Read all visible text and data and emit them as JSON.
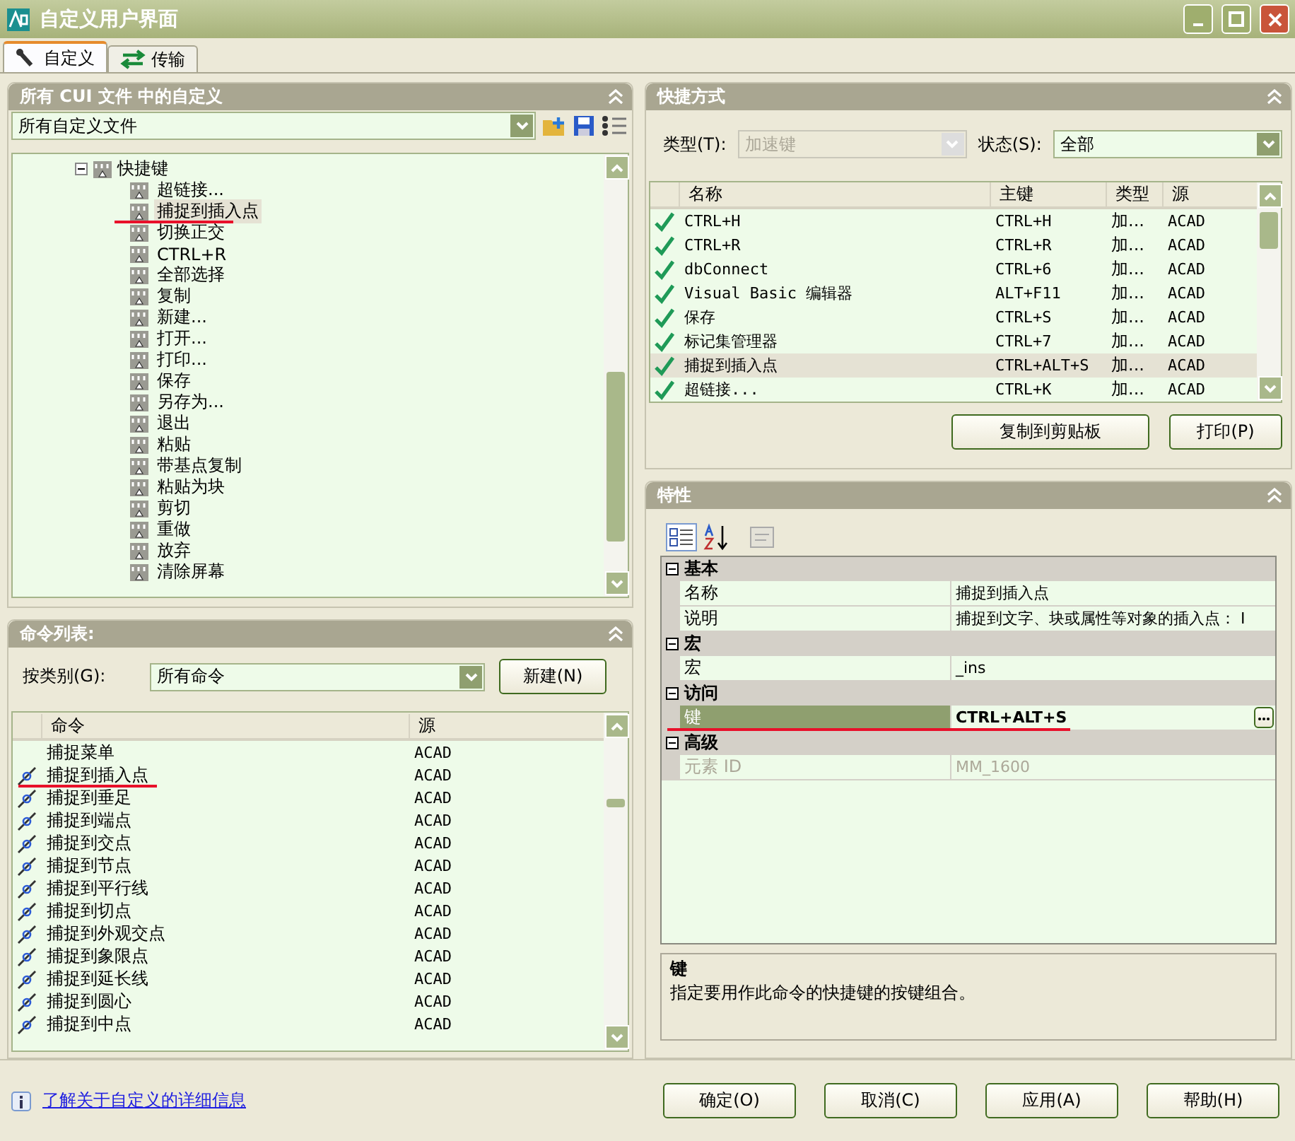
{
  "window": {
    "title": "自定义用户界面"
  },
  "tabs": [
    {
      "label": "自定义",
      "selected": true
    },
    {
      "label": "传输",
      "selected": false
    }
  ],
  "cui_panel": {
    "title": "所有 CUI 文件 中的自定义",
    "file_select": "所有自定义文件",
    "tree": {
      "label": "快捷键",
      "expanded": true,
      "children": [
        {
          "label": "超链接...",
          "selected": false,
          "marked": false
        },
        {
          "label": "捕捉到插入点",
          "selected": true,
          "marked": true
        },
        {
          "label": "切换正交",
          "selected": false,
          "marked": false
        },
        {
          "label": "CTRL+R",
          "selected": false,
          "marked": false
        },
        {
          "label": "全部选择",
          "selected": false,
          "marked": false
        },
        {
          "label": "复制",
          "selected": false,
          "marked": false
        },
        {
          "label": "新建...",
          "selected": false,
          "marked": false
        },
        {
          "label": "打开...",
          "selected": false,
          "marked": false
        },
        {
          "label": "打印...",
          "selected": false,
          "marked": false
        },
        {
          "label": "保存",
          "selected": false,
          "marked": false
        },
        {
          "label": "另存为...",
          "selected": false,
          "marked": false
        },
        {
          "label": "退出",
          "selected": false,
          "marked": false
        },
        {
          "label": "粘贴",
          "selected": false,
          "marked": false
        },
        {
          "label": "带基点复制",
          "selected": false,
          "marked": false
        },
        {
          "label": "粘贴为块",
          "selected": false,
          "marked": false
        },
        {
          "label": "剪切",
          "selected": false,
          "marked": false
        },
        {
          "label": "重做",
          "selected": false,
          "marked": false
        },
        {
          "label": "放弃",
          "selected": false,
          "marked": false
        },
        {
          "label": "清除屏幕",
          "selected": false,
          "marked": false
        }
      ]
    }
  },
  "command_panel": {
    "title": "命令列表:",
    "category_label": "按类别(G):",
    "category": "所有命令",
    "new_button": "新建(N)",
    "columns": [
      "命令",
      "源"
    ],
    "rows": [
      {
        "kind": "menu",
        "command": "捕捉菜单",
        "source": "ACAD",
        "selected": false,
        "marked": false
      },
      {
        "kind": "snap",
        "command": "捕捉到插入点",
        "source": "ACAD",
        "selected": false,
        "marked": true
      },
      {
        "kind": "snap",
        "command": "捕捉到垂足",
        "source": "ACAD",
        "selected": false,
        "marked": false
      },
      {
        "kind": "snap",
        "command": "捕捉到端点",
        "source": "ACAD",
        "selected": false,
        "marked": false
      },
      {
        "kind": "snap",
        "command": "捕捉到交点",
        "source": "ACAD",
        "selected": false,
        "marked": false
      },
      {
        "kind": "snap",
        "command": "捕捉到节点",
        "source": "ACAD",
        "selected": false,
        "marked": false
      },
      {
        "kind": "snap",
        "command": "捕捉到平行线",
        "source": "ACAD",
        "selected": false,
        "marked": false
      },
      {
        "kind": "snap",
        "command": "捕捉到切点",
        "source": "ACAD",
        "selected": false,
        "marked": false
      },
      {
        "kind": "snap",
        "command": "捕捉到外观交点",
        "source": "ACAD",
        "selected": false,
        "marked": false
      },
      {
        "kind": "snap",
        "command": "捕捉到象限点",
        "source": "ACAD",
        "selected": false,
        "marked": false
      },
      {
        "kind": "snap",
        "command": "捕捉到延长线",
        "source": "ACAD",
        "selected": false,
        "marked": false
      },
      {
        "kind": "snap",
        "command": "捕捉到圆心",
        "source": "ACAD",
        "selected": false,
        "marked": false
      },
      {
        "kind": "snap",
        "command": "捕捉到中点",
        "source": "ACAD",
        "selected": false,
        "marked": false
      }
    ]
  },
  "info_link": "了解关于自定义的详细信息",
  "shortcut_panel": {
    "title": "快捷方式",
    "type_label": "类型(T):",
    "type_value": "加速键",
    "type_disabled": true,
    "status_label": "状态(S):",
    "status_value": "全部",
    "columns": [
      "名称",
      "主键",
      "类型",
      "源"
    ],
    "rows": [
      {
        "name": "CTRL+H",
        "key": "CTRL+H",
        "type": "加...",
        "source": "ACAD",
        "selected": false
      },
      {
        "name": "CTRL+R",
        "key": "CTRL+R",
        "type": "加...",
        "source": "ACAD",
        "selected": false
      },
      {
        "name": "dbConnect",
        "key": "CTRL+6",
        "type": "加...",
        "source": "ACAD",
        "selected": false
      },
      {
        "name": "Visual Basic 编辑器",
        "key": "ALT+F11",
        "type": "加...",
        "source": "ACAD",
        "selected": false
      },
      {
        "name": "保存",
        "key": "CTRL+S",
        "type": "加...",
        "source": "ACAD",
        "selected": false
      },
      {
        "name": "标记集管理器",
        "key": "CTRL+7",
        "type": "加...",
        "source": "ACAD",
        "selected": false
      },
      {
        "name": "捕捉到插入点",
        "key": "CTRL+ALT+S",
        "type": "加...",
        "source": "ACAD",
        "selected": true
      },
      {
        "name": "超链接...",
        "key": "CTRL+K",
        "type": "加...",
        "source": "ACAD",
        "selected": false
      }
    ],
    "buttons": [
      "复制到剪贴板",
      "打印(P)"
    ]
  },
  "properties_panel": {
    "title": "特性",
    "groups": [
      {
        "name": "基本",
        "expanded": true,
        "rows": [
          {
            "label": "名称",
            "value": "捕捉到插入点",
            "selected": false
          },
          {
            "label": "说明",
            "value": "捕捉到文字、块或属性等对象的插入点： I",
            "selected": false
          }
        ]
      },
      {
        "name": "宏",
        "expanded": true,
        "rows": [
          {
            "label": "宏",
            "value": "_ins",
            "selected": false
          }
        ]
      },
      {
        "name": "访问",
        "expanded": true,
        "rows": [
          {
            "label": "键",
            "value": "CTRL+ALT+S",
            "selected": true,
            "marked": true
          }
        ]
      },
      {
        "name": "高级",
        "expanded": true,
        "rows": [
          {
            "label": "元素 ID",
            "value": "MM_1600",
            "selected": false,
            "disabled": true
          }
        ]
      }
    ],
    "help_title": "键",
    "help_text": "指定要用作此命令的快捷键的按键组合。"
  },
  "footer_buttons": [
    "确定(O)",
    "取消(C)",
    "应用(A)",
    "帮助(H)"
  ]
}
